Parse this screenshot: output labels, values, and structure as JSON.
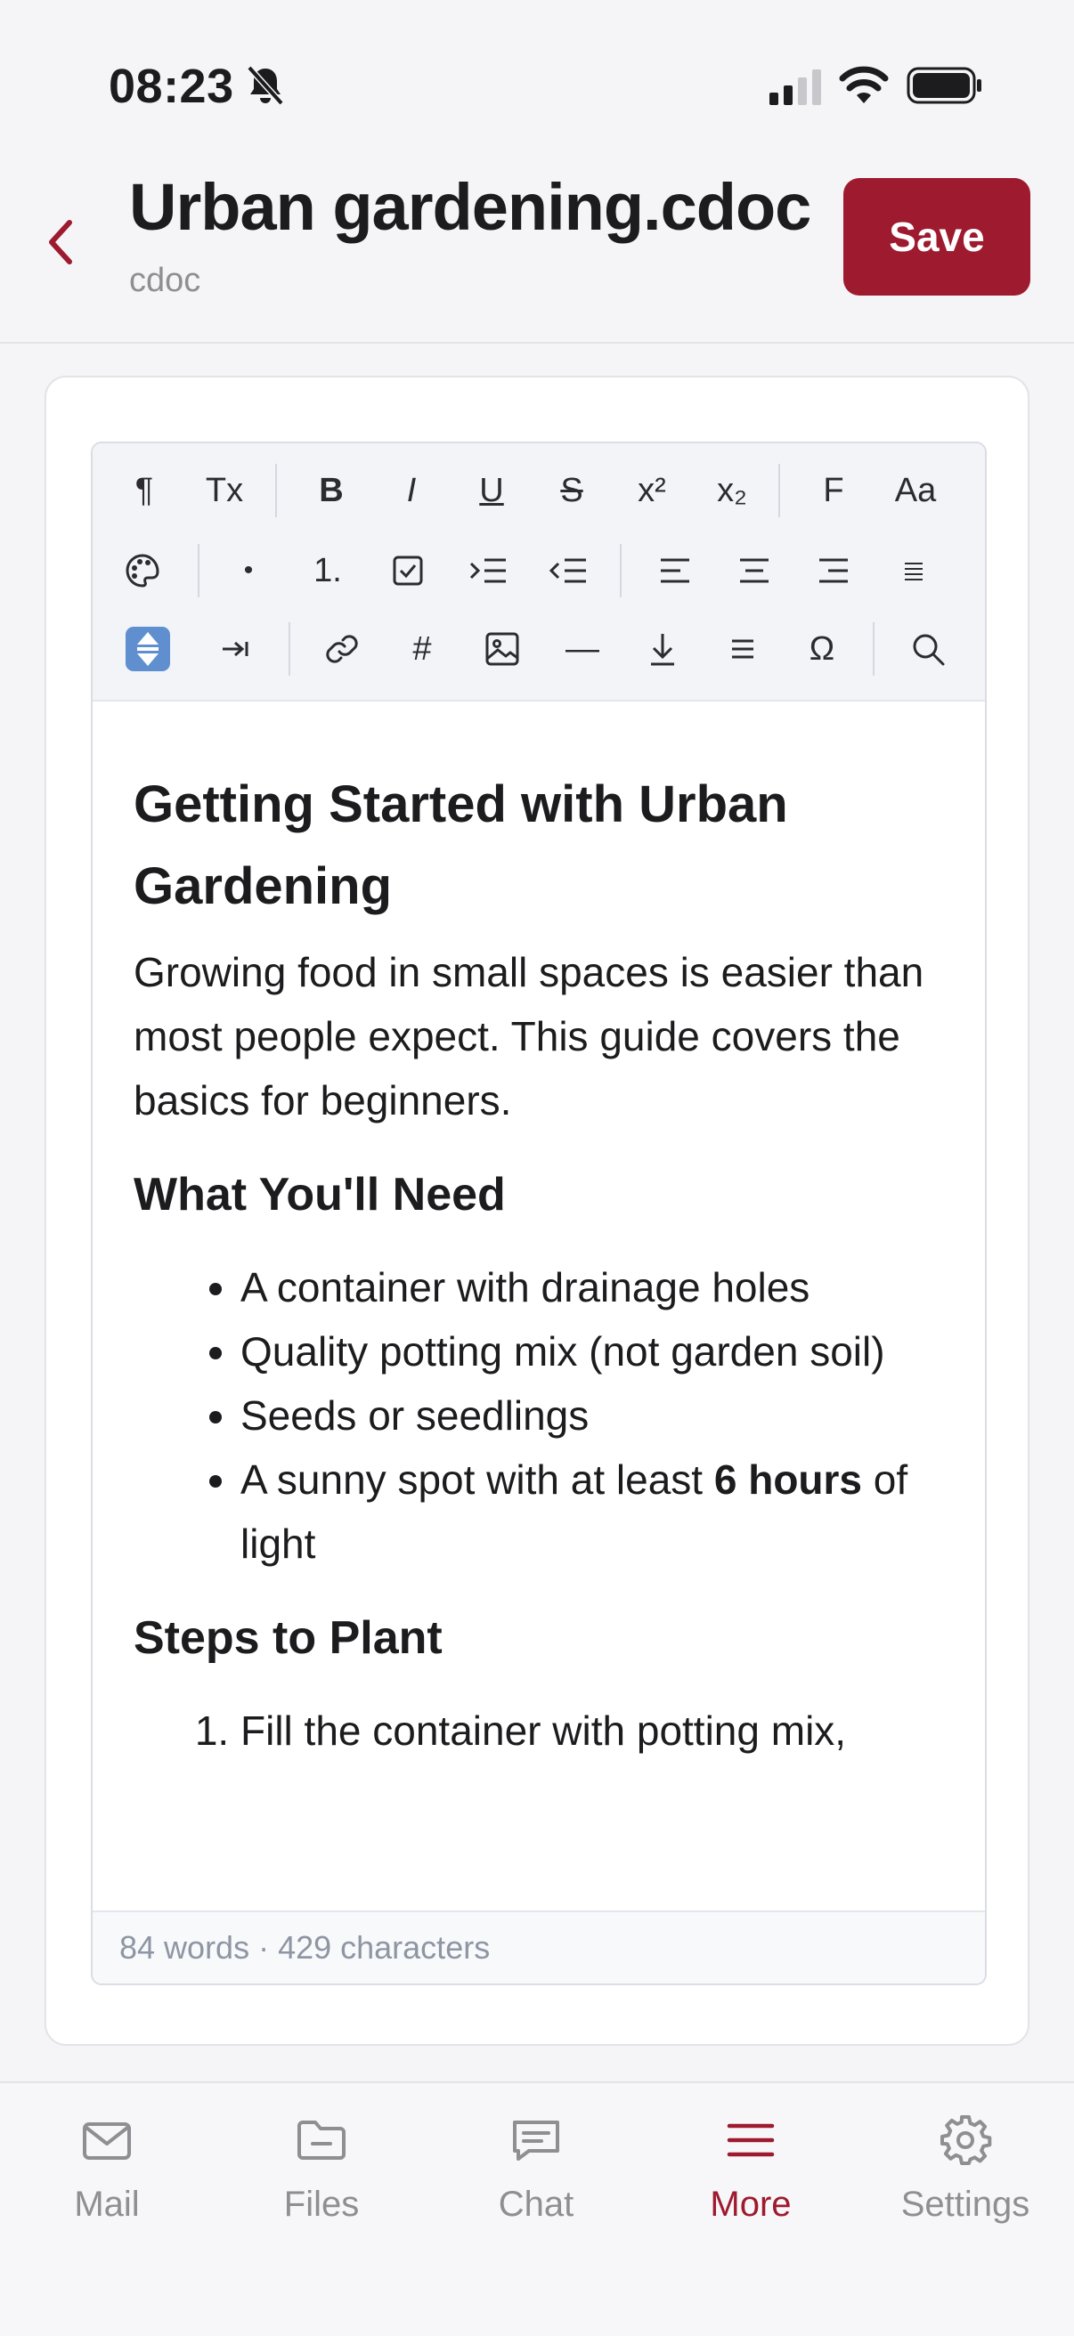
{
  "status": {
    "time": "08:23"
  },
  "header": {
    "title": "Urban gardening.cdoc",
    "subtitle": "cdoc",
    "save_label": "Save"
  },
  "toolbar": {
    "row1": [
      {
        "name": "paragraph",
        "label": "¶"
      },
      {
        "name": "clear-format",
        "label": "Tx"
      },
      {
        "name": "bold",
        "label": "B"
      },
      {
        "name": "italic",
        "label": "I"
      },
      {
        "name": "underline",
        "label": "U"
      },
      {
        "name": "strikethrough",
        "label": "S"
      },
      {
        "name": "superscript",
        "label": "x²"
      },
      {
        "name": "subscript",
        "label": "x₂"
      },
      {
        "name": "font",
        "label": "F"
      },
      {
        "name": "font-size",
        "label": "Aa"
      }
    ],
    "row2": [
      {
        "name": "bullet-list",
        "label": "•"
      },
      {
        "name": "numbered-list",
        "label": "1."
      }
    ],
    "row3": [
      {
        "name": "hashtag",
        "label": "#"
      },
      {
        "name": "horizontal-rule",
        "label": "—"
      },
      {
        "name": "special-char",
        "label": "Ω"
      }
    ]
  },
  "content": {
    "h1": "Getting Started with Urban Gardening",
    "intro": "Growing food in small spaces is easier than most people expect. This guide covers the basics for beginners.",
    "need_heading": "What You'll Need",
    "need_items": [
      "A container with drainage holes",
      "Quality potting mix (not garden soil)",
      "Seeds or seedlings"
    ],
    "need_item4_pre": "A sunny spot with at least ",
    "need_item4_bold": "6 hours",
    "need_item4_post": " of light",
    "steps_heading": "Steps to Plant",
    "steps": [
      "Fill the container with potting mix,"
    ]
  },
  "footer": {
    "stats": "84 words · 429 characters"
  },
  "tabs": [
    {
      "id": "mail",
      "label": "Mail",
      "icon": "mail-icon"
    },
    {
      "id": "files",
      "label": "Files",
      "icon": "folder-icon"
    },
    {
      "id": "chat",
      "label": "Chat",
      "icon": "chat-icon"
    },
    {
      "id": "more",
      "label": "More",
      "icon": "menu-icon",
      "active": true
    },
    {
      "id": "settings",
      "label": "Settings",
      "icon": "gear-icon"
    }
  ],
  "colors": {
    "accent": "#9e1a2e",
    "inactive": "#8e8e93"
  }
}
